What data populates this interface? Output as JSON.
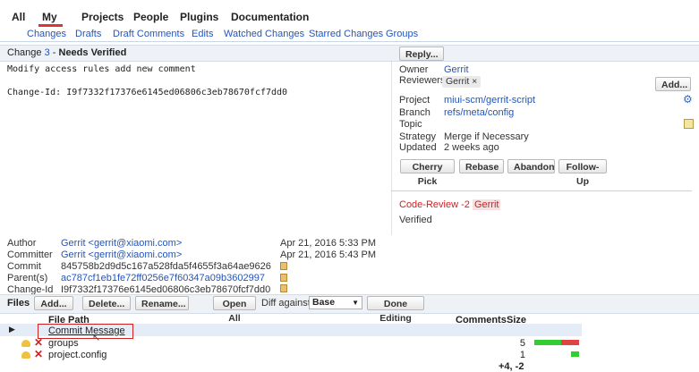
{
  "nav": {
    "primary": [
      "All",
      "My",
      "Projects",
      "People",
      "Plugins",
      "Documentation"
    ],
    "active": "My",
    "secondary": [
      "Changes",
      "Drafts",
      "Draft Comments",
      "Edits",
      "Watched Changes",
      "Starred Changes",
      "Groups"
    ]
  },
  "change": {
    "prefix": "Change ",
    "number": "3",
    "separator": " - ",
    "status": "Needs Verified",
    "reply_label": "Reply..."
  },
  "commit_message": {
    "subject": "Modify access rules add new comment",
    "change_id_line": "Change-Id: I9f7332f17376e6145ed06806c3eb78670fcf7dd0"
  },
  "info": {
    "owner_label": "Owner",
    "owner": "Gerrit",
    "reviewers_label": "Reviewers",
    "reviewer": "Gerrit ×",
    "add_label": "Add...",
    "project_label": "Project",
    "project": "miui-scm/gerrit-script",
    "branch_label": "Branch",
    "branch": "refs/meta/config",
    "topic_label": "Topic",
    "strategy_label": "Strategy",
    "strategy": "Merge if Necessary",
    "updated_label": "Updated",
    "updated": "2 weeks ago"
  },
  "actions": [
    "Cherry Pick",
    "Rebase",
    "Abandon",
    "Follow-Up"
  ],
  "labels": {
    "code_review": "Code-Review",
    "code_review_score": "-2",
    "code_review_by": "Gerrit",
    "verified": "Verified"
  },
  "commit_info": {
    "author_label": "Author",
    "author": "Gerrit <gerrit@xiaomi.com>",
    "author_date": "Apr 21, 2016 5:33 PM",
    "committer_label": "Committer",
    "committer": "Gerrit <gerrit@xiaomi.com>",
    "committer_date": "Apr 21, 2016 5:43 PM",
    "commit_label": "Commit",
    "commit": "845758b2d9d5c167a528fda5f4655f3a64ae9626",
    "parents_label": "Parent(s)",
    "parent": "ac787cf1eb1fe72ff0256e7f60347a09b3602997",
    "changeid_label": "Change-Id",
    "change_id": "I9f7332f17376e6145ed06806c3eb78670fcf7dd0"
  },
  "files_toolbar": {
    "label": "Files",
    "add": "Add...",
    "delete": "Delete...",
    "rename": "Rename...",
    "open_all": "Open All",
    "diff_against_label": "Diff against:",
    "diff_against_value": "Base",
    "done_editing": "Done Editing"
  },
  "file_table": {
    "header_path": "File Path",
    "header_comments": "Comments",
    "header_size": "Size",
    "rows": [
      {
        "name": "Commit Message",
        "count": ""
      },
      {
        "name": "groups",
        "count": "5"
      },
      {
        "name": "project.config",
        "count": "1"
      }
    ],
    "total": "+4, -2"
  },
  "colors": {
    "accent_link": "#2255bb",
    "nav_active": "#dd3333",
    "code_review_negative": "#cc2222",
    "added": "#33cc33",
    "removed": "#dd4444"
  }
}
